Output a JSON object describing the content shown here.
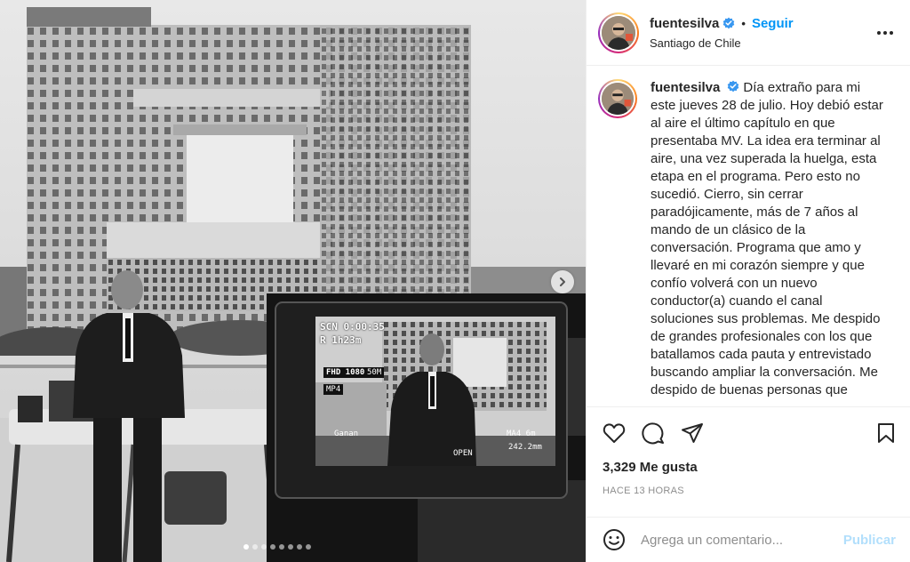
{
  "post": {
    "username": "fuentesilva",
    "follow_label": "Seguir",
    "separator": "•",
    "location": "Santiago de Chile",
    "caption": "Día extraño para mi este jueves 28 de julio. Hoy debió estar al aire el último capítulo en que presentaba MV. La idea era terminar al aire, una vez superada la huelga, esta etapa en el programa. Pero esto no sucedió. Cierro, sin cerrar paradójicamente, más de 7 años al mando de un clásico de la conversación. Programa que amo y llevaré en mi corazón siempre y que confío volverá con un nuevo conductor(a) cuando el canal soluciones sus problemas. Me despido de grandes profesionales con los que batallamos cada pauta y entrevistado buscando ampliar la conversación. Me despido de buenas personas que",
    "likes": "3,329 Me gusta",
    "time_ago": "HACE 13 HORAS"
  },
  "comment": {
    "placeholder": "Agrega un comentario...",
    "publish_label": "Publicar"
  },
  "camera_screen": {
    "scn": "SCN 0:00:35",
    "rec": "R 1h23m",
    "fhd": "FHD 1080",
    "bitrate": "50M",
    "mp4": "MP4",
    "gain": "Ganan",
    "open": "OPEN",
    "focal": "242.2mm",
    "iso": "MA4 6m"
  },
  "icons": {
    "verified": "verified-badge-icon",
    "more": "more-options-icon",
    "like": "heart-icon",
    "comment": "comment-icon",
    "share": "share-icon",
    "save": "bookmark-icon",
    "emoji": "emoji-icon",
    "next": "chevron-right-icon"
  },
  "colors": {
    "link_blue": "#0095f6",
    "publish_disabled": "#b2dffc",
    "verified_blue": "#3897f0"
  },
  "carousel": {
    "count": 8,
    "active_index": 0
  }
}
